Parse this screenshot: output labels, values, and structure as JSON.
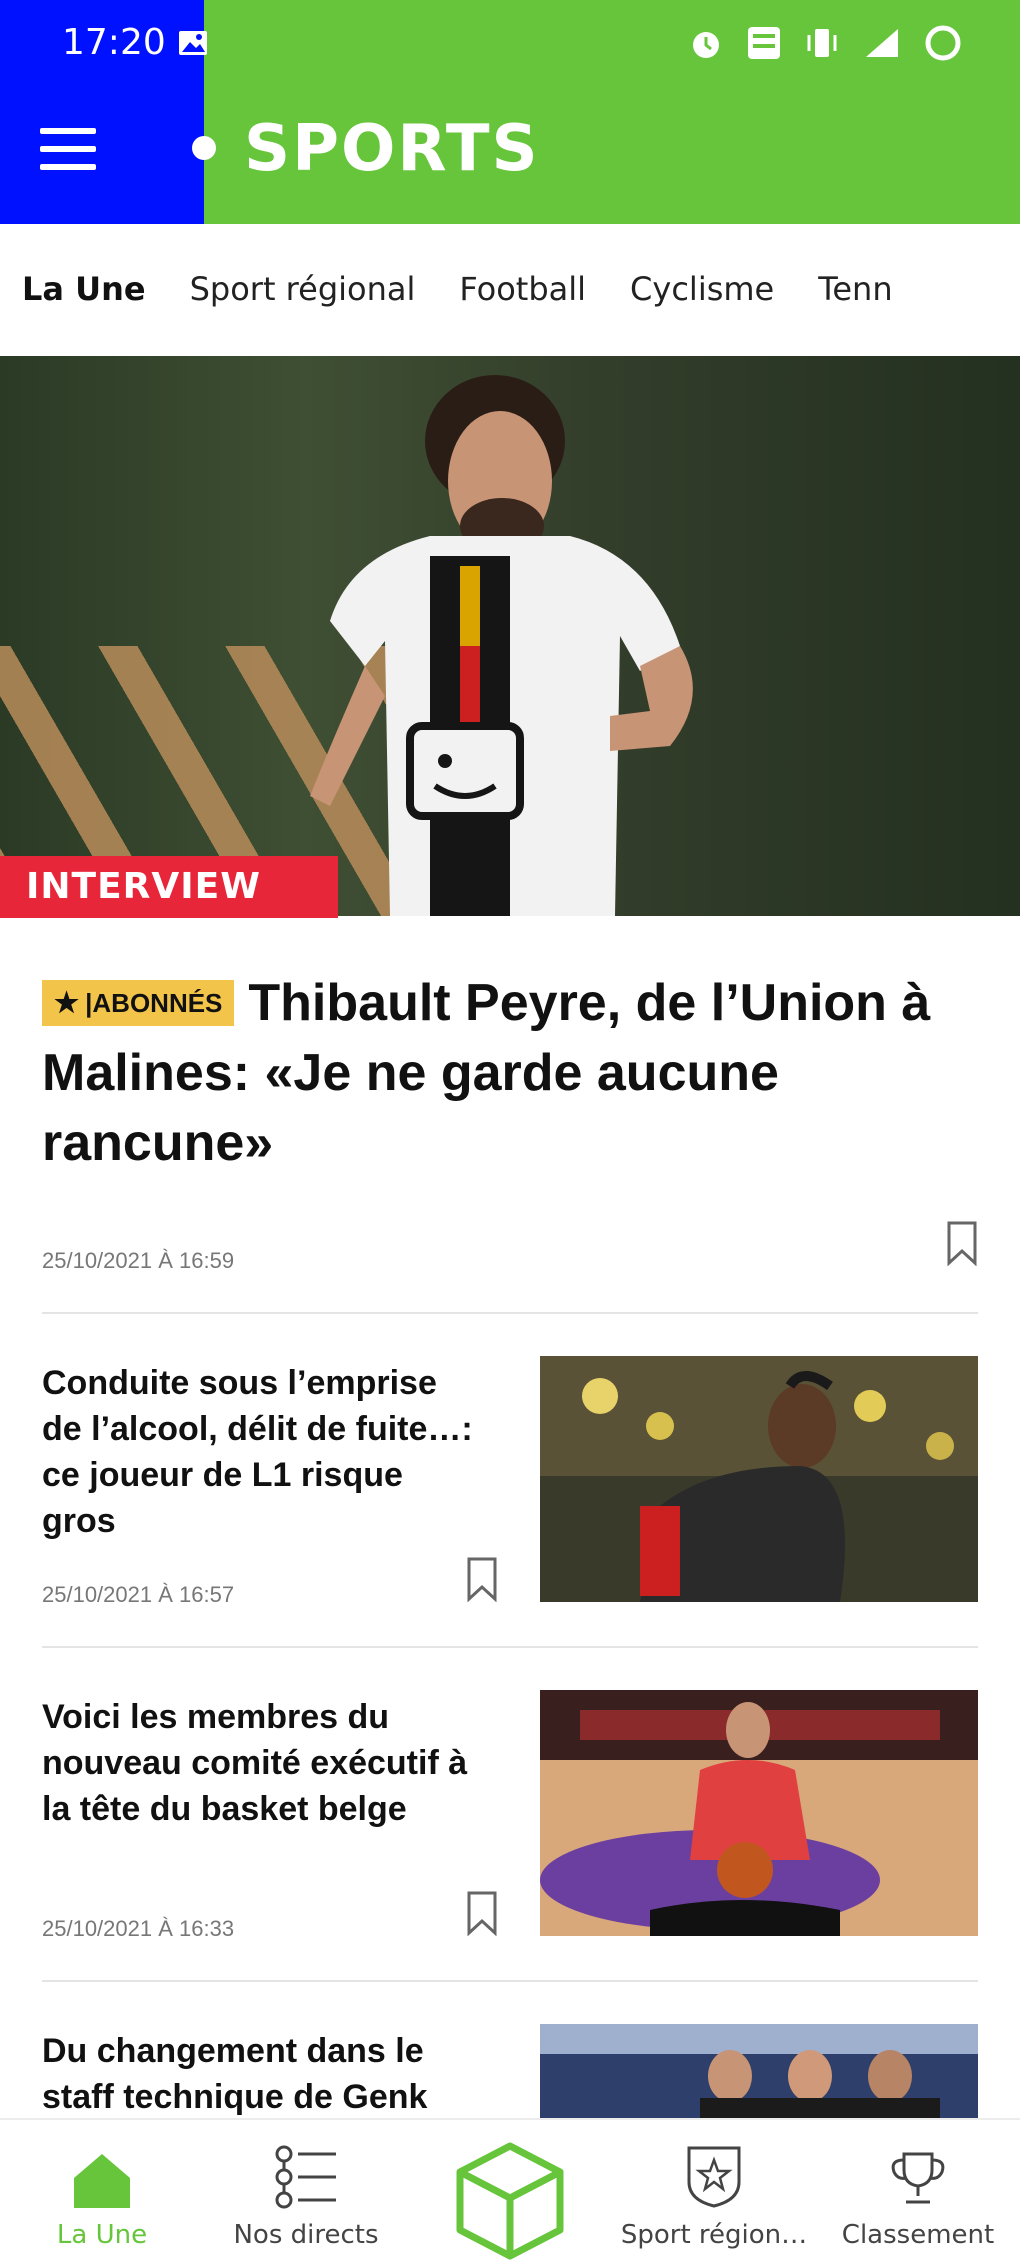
{
  "status_bar": {
    "time": "17:20"
  },
  "header": {
    "brand": "SPORTS",
    "colors": {
      "primary": "#66c53b",
      "left_block": "#0011ff"
    }
  },
  "tabs": [
    {
      "label": "La Une",
      "active": true
    },
    {
      "label": "Sport régional",
      "active": false
    },
    {
      "label": "Football",
      "active": false
    },
    {
      "label": "Cyclisme",
      "active": false
    },
    {
      "label": "Tenn",
      "active": false
    }
  ],
  "lead_article": {
    "category_badge": "INTERVIEW",
    "premium_badge": "ABONNÉS",
    "title": "Thibault Peyre, de l’Union à Malines: «Je ne garde aucune rancune»",
    "timestamp": "25/10/2021 À 16:59"
  },
  "articles": [
    {
      "title": "Conduite sous l’emprise de l’alcool, délit de fuite…: ce joueur de L1 risque gros",
      "timestamp": "25/10/2021 À 16:57"
    },
    {
      "title": "Voici les membres du nouveau comité exécutif à la tête du basket belge",
      "timestamp": "25/10/2021 À 16:33"
    },
    {
      "title": "Du changement dans le staff technique de Genk",
      "timestamp": ""
    }
  ],
  "bottom_nav": [
    {
      "label": "La Une",
      "icon": "home-icon",
      "active": true
    },
    {
      "label": "Nos directs",
      "icon": "list-icon",
      "active": false
    },
    {
      "label": "",
      "icon": "cube-icon",
      "active": false
    },
    {
      "label": "Sport région…",
      "icon": "shield-star-icon",
      "active": false
    },
    {
      "label": "Classement",
      "icon": "trophy-icon",
      "active": false
    }
  ]
}
